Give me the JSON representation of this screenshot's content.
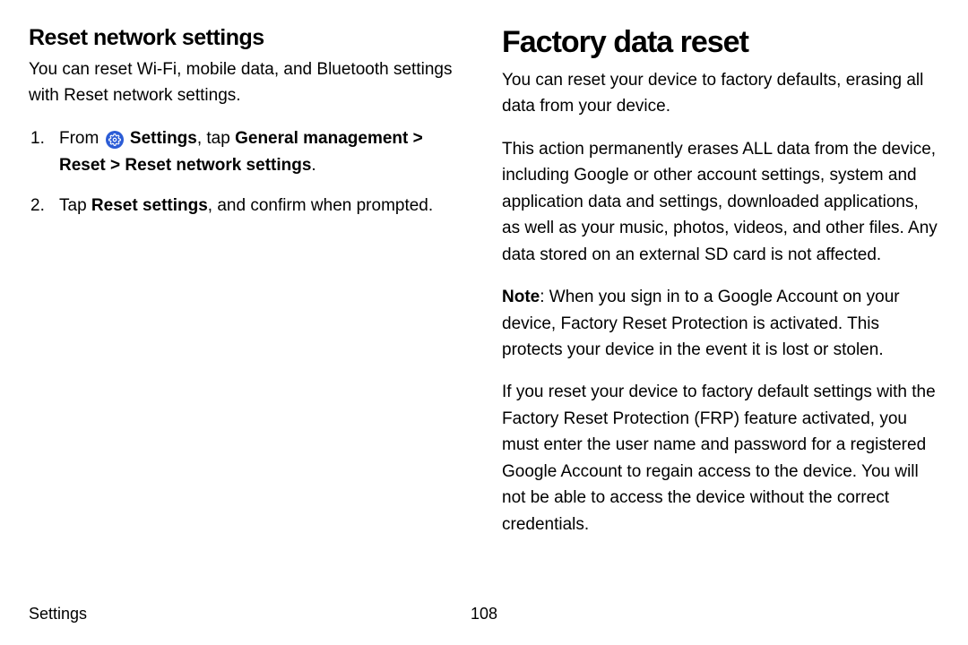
{
  "left": {
    "heading": "Reset network settings",
    "intro": "You can reset Wi-Fi, mobile data, and Bluetooth settings with Reset network settings.",
    "step1_pre": "From ",
    "step1_settings": "Settings",
    "step1_mid": ", tap ",
    "step1_gm": "General management",
    "step1_gt1": " > ",
    "step1_reset": "Reset",
    "step1_gt2": " > ",
    "step1_rns": "Reset network settings",
    "step1_end": ".",
    "step2_pre": "Tap ",
    "step2_bold": "Reset settings",
    "step2_post": ", and confirm when prompted."
  },
  "right": {
    "heading": "Factory data reset",
    "p1": "You can reset your device to factory defaults, erasing all data from your device.",
    "p2": "This action permanently erases ALL data from the device, including Google or other account settings, system and application data and settings, downloaded applications, as well as your music, photos, videos, and other files. Any data stored on an external SD card is not affected.",
    "note_label": "Note",
    "note_body": ": When you sign in to a Google Account on your device, Factory Reset Protection is activated. This protects your device in the event it is lost or stolen.",
    "p4": "If you reset your device to factory default settings with the Factory Reset Protection (FRP) feature activated, you must enter the user name and password for a registered Google Account to regain access to the device. You will not be able to access the device without the correct credentials."
  },
  "footer": {
    "section": "Settings",
    "page": "108"
  }
}
